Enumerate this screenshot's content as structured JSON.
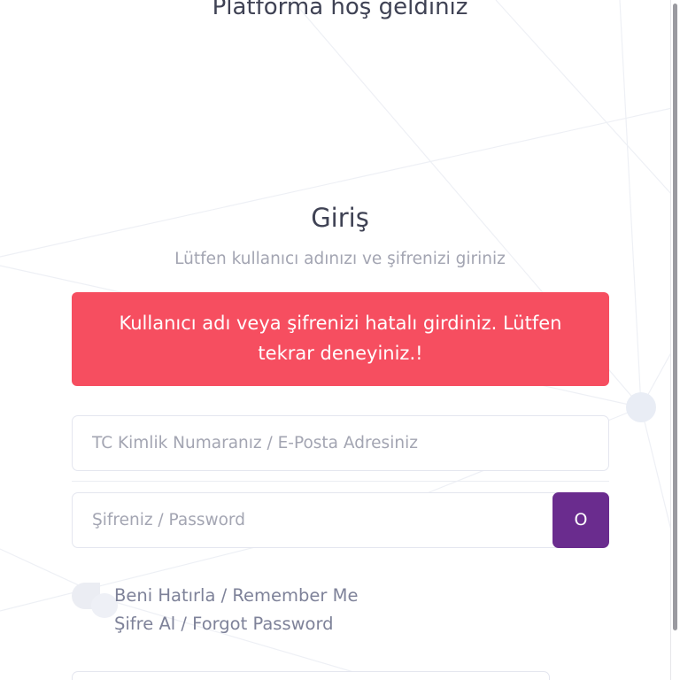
{
  "header": {
    "welcome": "Platforma hoş geldiniz"
  },
  "login": {
    "title": "Giriş",
    "subtitle": "Lütfen kullanıcı adınızı ve şifrenizi giriniz",
    "error": "Kullanıcı adı veya şifrenizi hatalı girdiniz. Lütfen tekrar deneyiniz.!",
    "username": {
      "value": "",
      "placeholder": "TC Kimlik Numaranız / E-Posta Adresiniz"
    },
    "password": {
      "value": "",
      "placeholder": "Şifreniz / Password",
      "toggle_label": "O"
    },
    "remember_label": "Beni Hatırla / Remember Me",
    "remember_checked": false,
    "forgot_label": "Şifre Al / Forgot Password"
  },
  "colors": {
    "alert": "#f64e60",
    "accent": "#6a2c8e",
    "heading": "#3f4254",
    "muted": "#a3a5b2"
  }
}
